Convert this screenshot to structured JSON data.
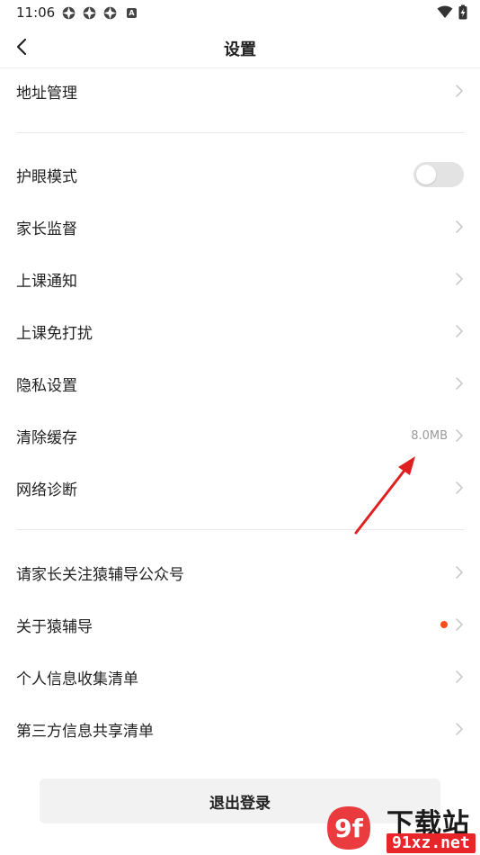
{
  "status_bar": {
    "time": "11:06",
    "notif_badge": "A"
  },
  "header": {
    "title": "设置",
    "back_icon": "back-arrow-icon"
  },
  "rows": {
    "address": {
      "label": "地址管理"
    },
    "eye_mode": {
      "label": "护眼模式",
      "toggle_on": false
    },
    "parent_supervision": {
      "label": "家长监督"
    },
    "class_notice": {
      "label": "上课通知"
    },
    "class_dnd": {
      "label": "上课免打扰"
    },
    "privacy": {
      "label": "隐私设置"
    },
    "clear_cache": {
      "label": "清除缓存",
      "value": "8.0MB"
    },
    "network_diag": {
      "label": "网络诊断"
    },
    "follow_account": {
      "label": "请家长关注猿辅导公众号"
    },
    "about": {
      "label": "关于猿辅导",
      "has_red_dot": true
    },
    "personal_info": {
      "label": "个人信息收集清单"
    },
    "third_party": {
      "label": "第三方信息共享清单"
    }
  },
  "logout": {
    "label": "退出登录"
  },
  "watermark": {
    "title": "下载站",
    "url": "91xz.net",
    "logo_text": "9f"
  },
  "colors": {
    "accent_dot": "#ff4d1a",
    "annotation_arrow": "#e02020",
    "toggle_off": "#e3e3e3"
  }
}
